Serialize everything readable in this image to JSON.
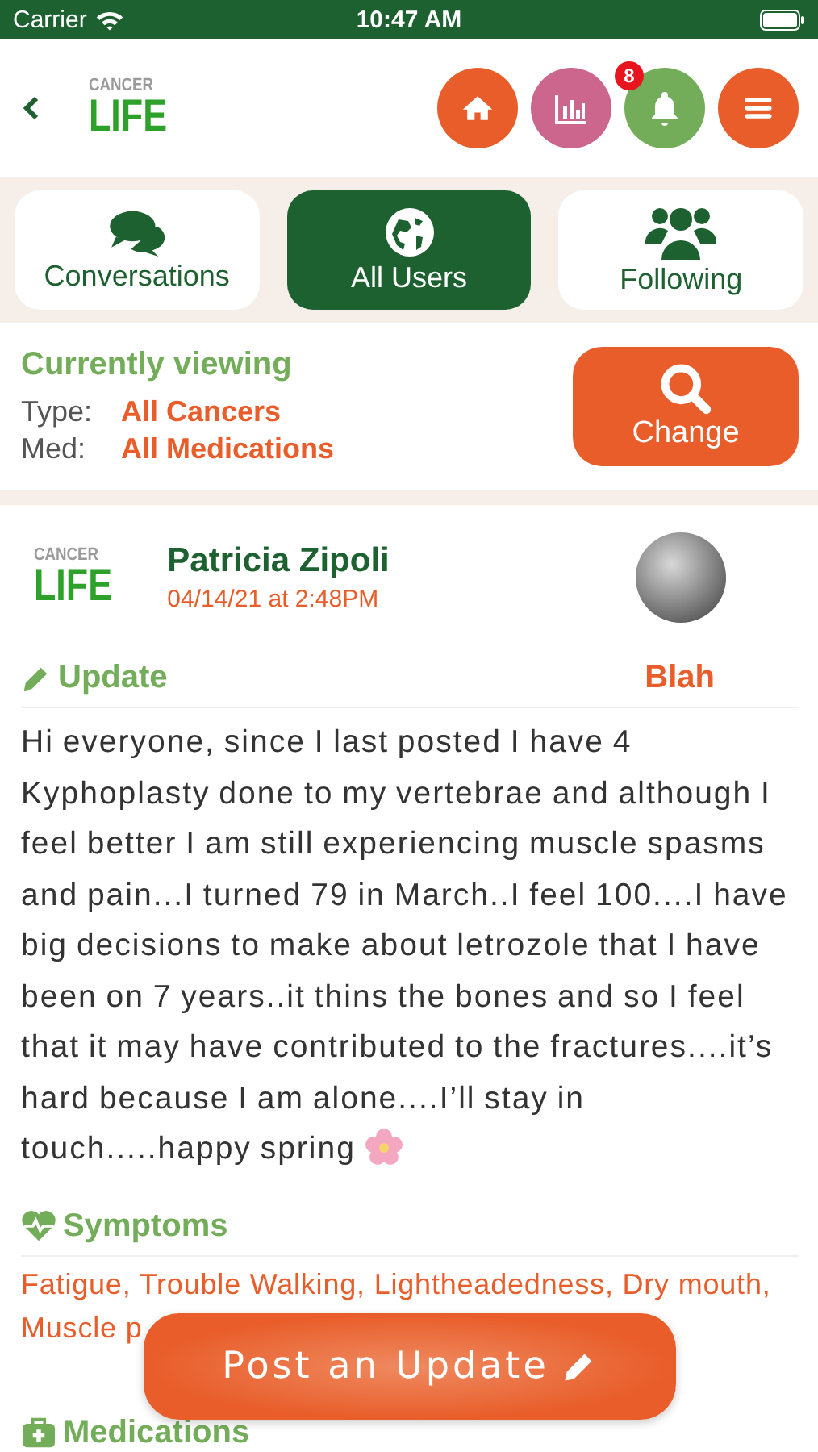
{
  "status_bar": {
    "carrier": "Carrier",
    "time": "10:47 AM"
  },
  "header": {
    "logo": {
      "top": "CANCER",
      "bottom": "LIFE"
    },
    "nav_buttons": [
      {
        "kind": "home",
        "color": "#e85d2a"
      },
      {
        "kind": "chart",
        "color": "#cc668c"
      },
      {
        "kind": "bell",
        "color": "#74ad5a",
        "badge": "8"
      },
      {
        "kind": "menu",
        "color": "#e85d2a"
      }
    ]
  },
  "tabs": [
    {
      "kind": "chat",
      "label": "Conversations",
      "selected": false
    },
    {
      "kind": "globe",
      "label": "All Users",
      "selected": true
    },
    {
      "kind": "people",
      "label": "Following",
      "selected": false
    }
  ],
  "filter": {
    "title": "Currently viewing",
    "rows": [
      {
        "label": "Type:",
        "value": "All Cancers"
      },
      {
        "label": "Med:",
        "value": "All Medications"
      }
    ],
    "button": "Change"
  },
  "post": {
    "logo": {
      "top": "CANCER",
      "bottom": "LIFE"
    },
    "author": "Patricia Zipoli",
    "timestamp": "04/14/21 at 2:48PM",
    "type": "Update",
    "mood": "Blah",
    "body": "Hi everyone, since I last posted I have 4 Kyphoplasty done to my vertebrae and although I feel better I am still experiencing muscle spasms and pain...I turned 79 in March..I feel 100....I have big decisions to make about letrozole that I have been on 7 years..it thins the bones and so I feel that it may have contributed to the fractures....it’s hard because I am alone....I’ll stay in touch.....happy spring",
    "sections": [
      {
        "kind": "symptoms",
        "title": "Symptoms",
        "text": "Fatigue, Trouble Walking, Lightheadedness, Dry mouth, Muscle p"
      },
      {
        "kind": "medications",
        "title": "Medications"
      }
    ]
  },
  "post_button": "Post an Update"
}
